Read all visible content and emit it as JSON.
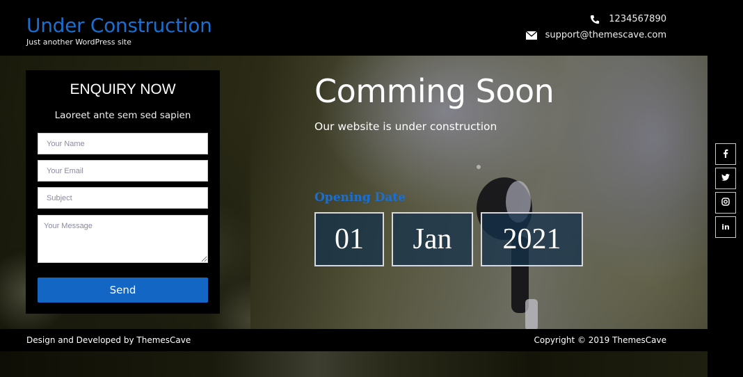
{
  "header": {
    "site_title": "Under Construction",
    "tagline": "Just another WordPress site",
    "phone": "1234567890",
    "email": "support@themescave.com",
    "phone_icon": "phone-icon",
    "email_icon": "envelope-icon"
  },
  "enquiry": {
    "title": "ENQUIRY NOW",
    "subtitle": "Laoreet ante sem sed sapien",
    "fields": {
      "name_placeholder": "Your Name",
      "email_placeholder": "Your Email",
      "subject_placeholder": "Subject",
      "message_placeholder": "Your Message"
    },
    "send_label": "Send"
  },
  "hero": {
    "title": "Comming Soon",
    "subtitle": "Our website is under construction",
    "opening_label": "Opening Date",
    "date": {
      "day": "01",
      "month": "Jan",
      "year": "2021"
    }
  },
  "social": [
    {
      "name": "facebook",
      "glyph": "f"
    },
    {
      "name": "twitter",
      "glyph": "twitter"
    },
    {
      "name": "instagram",
      "glyph": "instagram"
    },
    {
      "name": "linkedin",
      "glyph": "in"
    }
  ],
  "footer": {
    "left": "Design and Developed by ThemesCave",
    "right": "Copyright © 2019 ThemesCave"
  },
  "colors": {
    "accent": "#1a6fd1",
    "button": "#1366c4",
    "date_box_bg": "#14324b"
  }
}
